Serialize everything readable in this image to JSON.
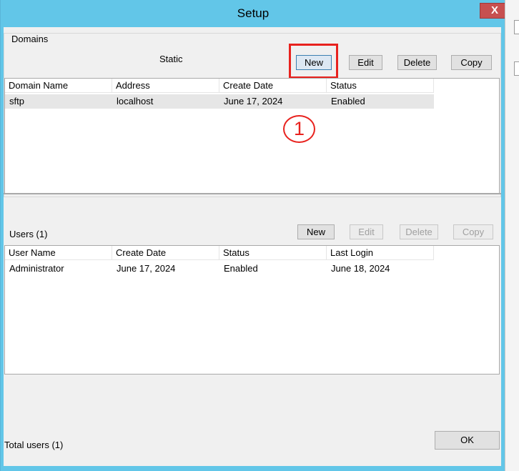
{
  "window": {
    "title": "Setup",
    "close_glyph": "X"
  },
  "domains": {
    "group_label": "Domains",
    "mode_label": "Static",
    "buttons": {
      "new": "New",
      "edit": "Edit",
      "delete": "Delete",
      "copy": "Copy"
    },
    "columns": [
      "Domain Name",
      "Address",
      "Create Date",
      "Status"
    ],
    "rows": [
      {
        "domain_name": "sftp",
        "address": "localhost",
        "create_date": "June 17, 2024",
        "status": "Enabled"
      }
    ]
  },
  "users": {
    "label": "Users (1)",
    "buttons": {
      "new": "New",
      "edit": "Edit",
      "delete": "Delete",
      "copy": "Copy"
    },
    "columns": [
      "User Name",
      "Create Date",
      "Status",
      "Last Login"
    ],
    "rows": [
      {
        "user_name": "Administrator",
        "create_date": "June 17, 2024",
        "status": "Enabled",
        "last_login": "June 18, 2024"
      }
    ]
  },
  "footer": {
    "total_users": "Total users (1)",
    "ok_label": "OK"
  },
  "annotation": {
    "step_number": "1"
  },
  "colors": {
    "title_bar": "#62c6e8",
    "close_button": "#c75050",
    "highlight": "#e8221e"
  }
}
